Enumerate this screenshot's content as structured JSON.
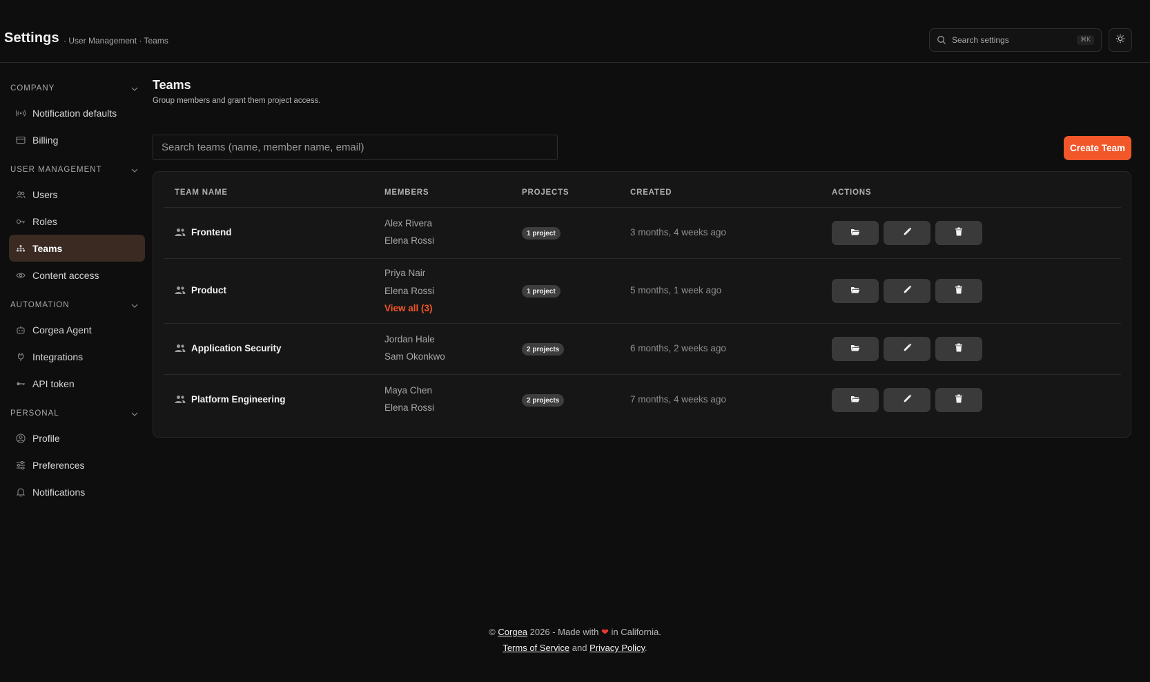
{
  "header": {
    "title": "Settings",
    "breadcrumb": "· User Management · Teams",
    "search_placeholder": "Search settings",
    "search_shortcut": "⌘K"
  },
  "sidebar": {
    "sections": [
      {
        "title": "COMPANY",
        "items": [
          {
            "label": "Notification defaults",
            "icon": "broadcast-icon"
          },
          {
            "label": "Billing",
            "icon": "credit-card-icon"
          }
        ]
      },
      {
        "title": "USER MANAGEMENT",
        "items": [
          {
            "label": "Users",
            "icon": "users-icon"
          },
          {
            "label": "Roles",
            "icon": "key-icon"
          },
          {
            "label": "Teams",
            "icon": "team-hierarchy-icon",
            "active": true
          },
          {
            "label": "Content access",
            "icon": "eye-icon"
          }
        ]
      },
      {
        "title": "AUTOMATION",
        "items": [
          {
            "label": "Corgea Agent",
            "icon": "robot-icon"
          },
          {
            "label": "Integrations",
            "icon": "plug-icon"
          },
          {
            "label": "API token",
            "icon": "token-key-icon"
          }
        ]
      },
      {
        "title": "PERSONAL",
        "items": [
          {
            "label": "Profile",
            "icon": "user-circle-icon"
          },
          {
            "label": "Preferences",
            "icon": "sliders-icon"
          },
          {
            "label": "Notifications",
            "icon": "bell-icon"
          }
        ]
      }
    ]
  },
  "main": {
    "title": "Teams",
    "description": "Group members and grant them project access.",
    "search_placeholder": "Search teams (name, member name, email)",
    "create_label": "Create Team",
    "columns": [
      "TEAM NAME",
      "MEMBERS",
      "PROJECTS",
      "CREATED",
      "ACTIONS"
    ],
    "rows": [
      {
        "name": "Frontend",
        "members": [
          "Alex Rivera",
          "Elena Rossi"
        ],
        "view_all": "",
        "projects": "1 project",
        "created": "3 months, 4 weeks ago"
      },
      {
        "name": "Product",
        "members": [
          "Priya Nair",
          "Elena Rossi"
        ],
        "view_all": "View all (3)",
        "projects": "1 project",
        "created": "5 months, 1 week ago"
      },
      {
        "name": "Application Security",
        "members": [
          "Jordan Hale",
          "Sam Okonkwo"
        ],
        "view_all": "",
        "projects": "2 projects",
        "created": "6 months, 2 weeks ago"
      },
      {
        "name": "Platform Engineering",
        "members": [
          "Maya Chen",
          "Elena Rossi"
        ],
        "view_all": "",
        "projects": "2 projects",
        "created": "7 months, 4 weeks ago"
      }
    ]
  },
  "footer": {
    "copyright": "©",
    "brand": "Corgea",
    "made_with": "2026 - Made with",
    "heart": "❤",
    "location": "in California.",
    "terms": "Terms of Service",
    "and": "and",
    "privacy": "Privacy Policy",
    "period": "."
  },
  "colors": {
    "accent": "#f2572a",
    "background": "#0e0e0e",
    "active_nav": "#3a2a22"
  }
}
